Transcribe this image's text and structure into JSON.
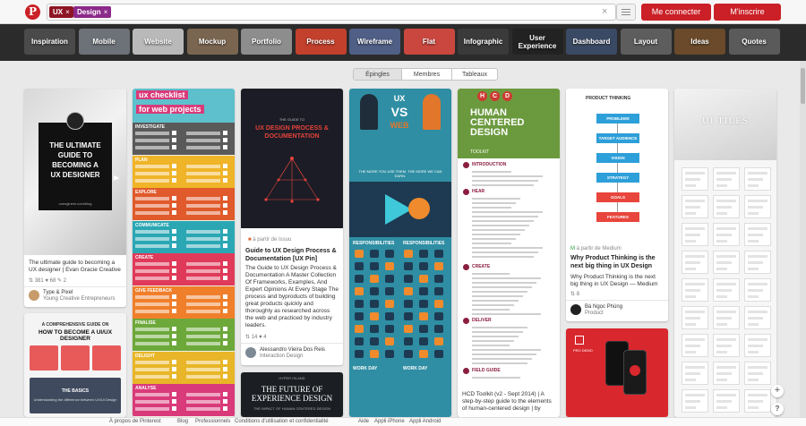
{
  "header": {
    "logo": "P",
    "search_tokens": [
      {
        "label": "UX",
        "color": "#8e1525"
      },
      {
        "label": "Design",
        "color": "#8b2a8a"
      }
    ],
    "clear_glyph": "×",
    "login_label": "Me connecter",
    "signup_label": "M'inscrire"
  },
  "categories": [
    {
      "label": "Inspiration",
      "bg": "#4a4a4a"
    },
    {
      "label": "Mobile",
      "bg": "#6d7178"
    },
    {
      "label": "Website",
      "bg": "#b9b9b9"
    },
    {
      "label": "Mockup",
      "bg": "#7a6550"
    },
    {
      "label": "Portfolio",
      "bg": "#8d8d8d"
    },
    {
      "label": "Process",
      "bg": "#c2402c"
    },
    {
      "label": "Wireframe",
      "bg": "#4f5f86"
    },
    {
      "label": "Flat",
      "bg": "#c9473e"
    },
    {
      "label": "Infographic",
      "bg": "#3a3a3a"
    },
    {
      "label": "User Experience",
      "bg": "#222222"
    },
    {
      "label": "Dashboard",
      "bg": "#3b4a64"
    },
    {
      "label": "Layout",
      "bg": "#5d5d5d"
    },
    {
      "label": "Ideas",
      "bg": "#6a4a2a"
    },
    {
      "label": "Quotes",
      "bg": "#5a5a5a"
    }
  ],
  "tabs": [
    {
      "label": "Épingles",
      "active": true
    },
    {
      "label": "Membres",
      "active": false
    },
    {
      "label": "Tableaux",
      "active": false
    }
  ],
  "pins": {
    "p1": {
      "image_lines": [
        "THE ULTIMATE",
        "GUIDE TO",
        "BECOMING A",
        "UX DESIGNER"
      ],
      "image_footer": "uxengineer.com/blog",
      "desc": "The ultimate guide to becoming a UX designer | Evan Gracie Creative",
      "stats": "⇅ 381  ♥ 68  ✎ 2",
      "author": "Type & Pixel",
      "board": "Young Creative Entrepreneurs"
    },
    "p1b": {
      "heading": "A COMPREHENSIVE GUIDE ON",
      "title": "HOW TO BECOME A UI/UX DESIGNER",
      "section": "THE BASICS",
      "sub": "Understanding the difference between UX/UI Design"
    },
    "p2": {
      "title_top": "ux checklist",
      "title_bottom": "for web projects",
      "sections": [
        "INVESTIGATE",
        "PLAN",
        "EXPLORE",
        "COMMUNICATE",
        "CREATE",
        "GIVE FEEDBACK",
        "FINALISE",
        "DELIGHT",
        "ANALYSE"
      ]
    },
    "p3": {
      "img_small": "THE GUIDE TO",
      "img_title": "UX DESIGN PROCESS & DOCUMENTATION",
      "via": "à partir de Issuu",
      "title": "Guide to UX Design Process & Documentation [UX Pin]",
      "desc": "The Guide to UX Design Process & Documentation A Master Collection Of Frameworks, Examples, And Expert Opinions At Every Stage The process and byproducts of building great products quickly and thoroughly as researched across the web and practiced by industry leaders.",
      "stats": "⇅ 14  ♥ 4",
      "author": "Alessandro Vieira Dos Reis",
      "board": "Interaction Design"
    },
    "p3b": {
      "tag": "HYPER ISLAND",
      "title": "THE FUTURE OF EXPERIENCE DESIGN",
      "sub": "THE IMPACT OF HUMAN CENTERED DESIGN"
    },
    "p4": {
      "left_label": "UX",
      "vs": "VS",
      "right_label": "WEB",
      "tagline": "THE MORE YOU USE THEM, THE MORE WE CAN EARN.",
      "section1": "RESPONSIBILITIES",
      "section2": "WORK DAY"
    },
    "p5": {
      "letters": [
        "H",
        "C",
        "D"
      ],
      "title": "HUMAN CENTERED DESIGN",
      "toolkit": "TOOLKIT",
      "sections": [
        "INTRODUCTION",
        "HEAR",
        "CREATE",
        "DELIVER",
        "FIELD GUIDE"
      ],
      "title_text": "HCD Toolkit (v2 - Sept 2014) | A step-by-step guide to the elements of human-centered design | by"
    },
    "p6": {
      "image_title": "PRODUCT THINKING",
      "flow": [
        "PROBLEMS",
        "TARGET AUDIENCE",
        "VISION",
        "STRATEGY",
        "GOALS",
        "FEATURES"
      ],
      "via": "à partir de Medium",
      "title": "Why Product Thinking is the next big thing in UX Design",
      "desc": "Why Product Thinking is the next big thing in UX Design — Medium",
      "stats": "⇅ 8",
      "author": "Bá Ngọc Phùng",
      "board": "Product"
    },
    "p6b": {
      "label": "PRO DEMO"
    },
    "p7": {
      "image_title": "UI TILES"
    }
  },
  "footer": {
    "links": [
      "À propos de Pinterest",
      "Blog",
      "Professionnels",
      "Conditions d'utilisation et confidentialité",
      "Aide",
      "Appli iPhone",
      "Appli Android"
    ]
  },
  "floating": {
    "plus": "+",
    "help": "?"
  },
  "colors": {
    "brand": "#cb2027",
    "background": "#e9e9e9"
  }
}
